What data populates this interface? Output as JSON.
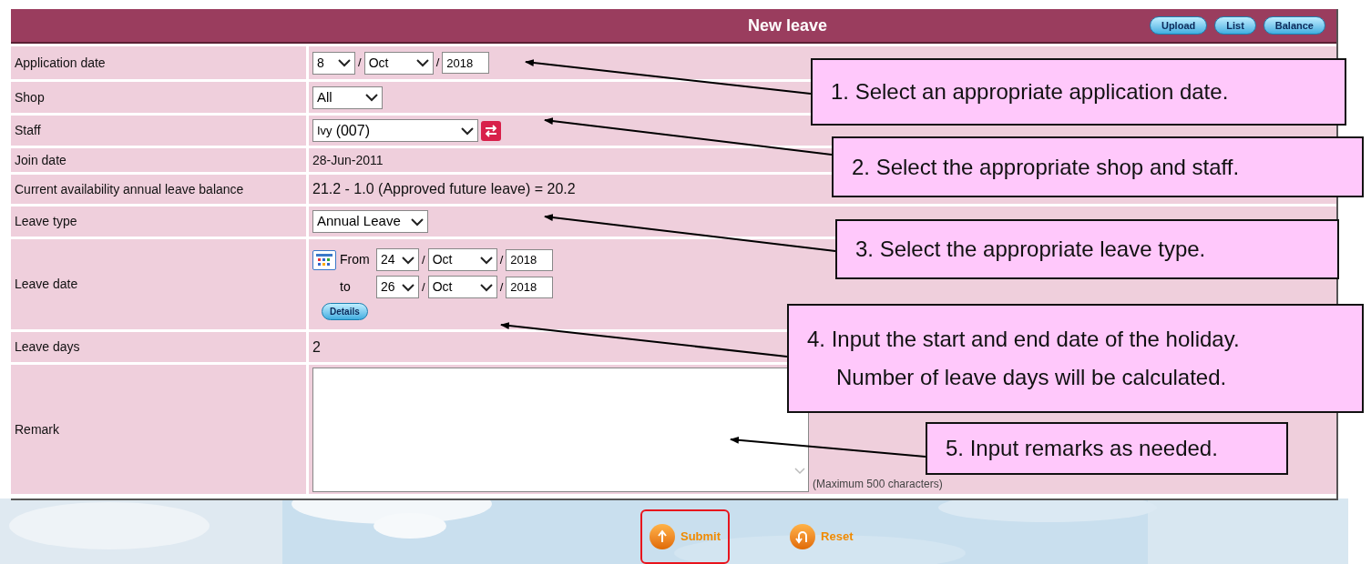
{
  "header": {
    "title": "New leave",
    "buttons": [
      "Upload",
      "List",
      "Balance"
    ]
  },
  "rows": [
    {
      "label": "Application date",
      "kind": "date",
      "day": "8",
      "month": "Oct",
      "year": "2018",
      "separators": [
        "/",
        "/"
      ]
    },
    {
      "label": "Shop",
      "kind": "select",
      "value": "All"
    },
    {
      "label": "Staff",
      "kind": "staff",
      "name": "Ivy",
      "code": "(007)"
    },
    {
      "label": "Join date",
      "kind": "text",
      "value": "28-Jun-2011"
    },
    {
      "label": "Current availability annual leave balance",
      "kind": "text",
      "value": "21.2 - 1.0 (Approved future leave) = 20.2"
    },
    {
      "label": "Leave type",
      "kind": "select",
      "value": "Annual Leave"
    },
    {
      "label": "Leave date",
      "kind": "range",
      "from_label": "From",
      "from": {
        "day": "24",
        "month": "Oct",
        "year": "2018",
        "separators": [
          "/",
          "/"
        ]
      },
      "to_label": "to",
      "to": {
        "day": "26",
        "month": "Oct",
        "year": "2018",
        "separators": [
          "/",
          "/"
        ]
      },
      "button": "Details"
    },
    {
      "label": "Leave days",
      "kind": "text",
      "value": "2"
    },
    {
      "label": "Remark",
      "kind": "textarea",
      "note": "(Maximum 500 characters)"
    }
  ],
  "actions": [
    {
      "label": "Submit",
      "highlighted": true
    },
    {
      "label": "Reset",
      "highlighted": false
    }
  ],
  "callouts": [
    {
      "lines": [
        "1. Select an appropriate application date."
      ]
    },
    {
      "lines": [
        "2. Select the appropriate shop and staff."
      ]
    },
    {
      "lines": [
        "3. Select the appropriate leave type."
      ]
    },
    {
      "lines": [
        "4. Input the start and end date of the holiday.",
        "Number of leave days will be calculated."
      ]
    },
    {
      "lines": [
        "5. Input remarks as needed."
      ]
    }
  ]
}
